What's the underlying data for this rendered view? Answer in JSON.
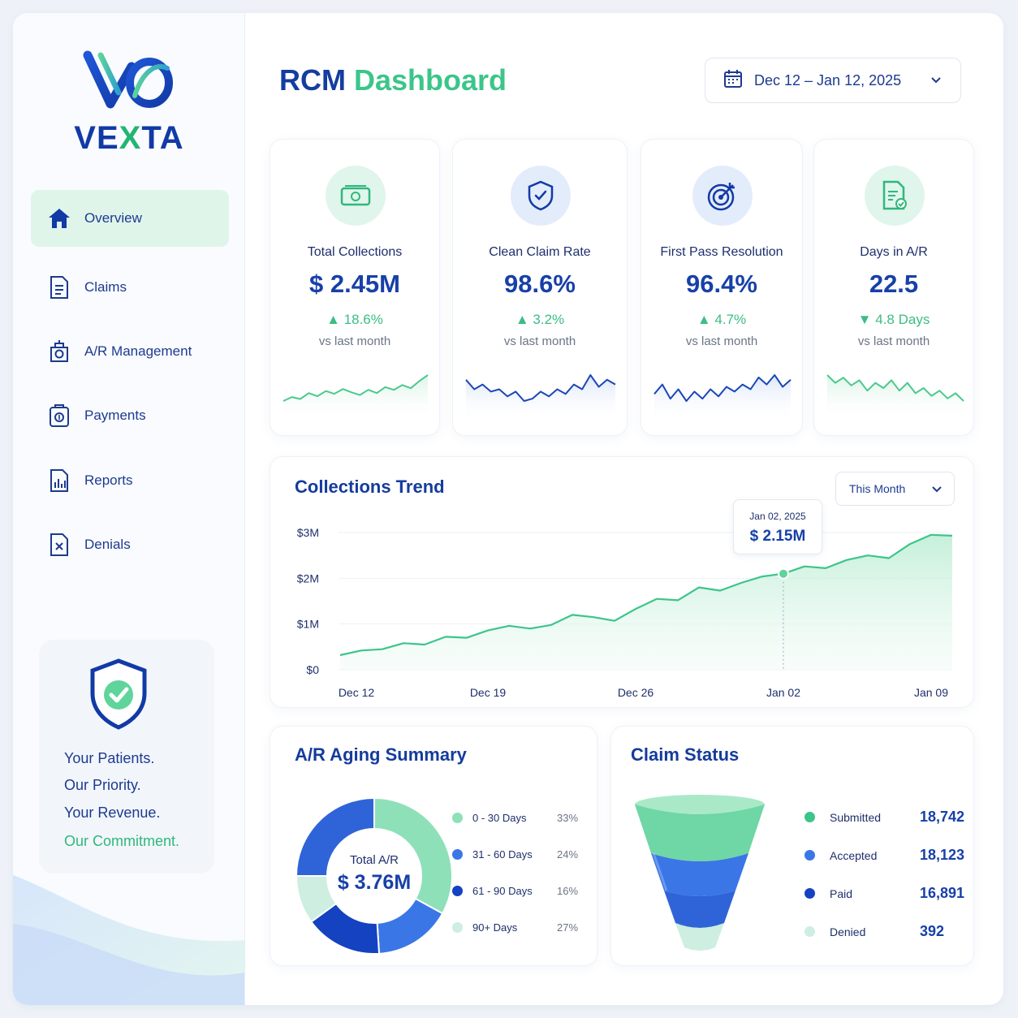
{
  "brand": {
    "name_left": "VE",
    "name_x": "X",
    "name_right": "TA"
  },
  "nav": [
    {
      "label": "Overview",
      "icon": "home-icon",
      "active": true
    },
    {
      "label": "Claims",
      "icon": "document-icon"
    },
    {
      "label": "A/R Management",
      "icon": "ar-management-icon"
    },
    {
      "label": "Payments",
      "icon": "payments-icon"
    },
    {
      "label": "Reports",
      "icon": "reports-icon"
    },
    {
      "label": "Denials",
      "icon": "denials-icon"
    }
  ],
  "promo": {
    "icon": "shield-check-icon",
    "line1": "Your Patients.",
    "line2": "Our Priority.",
    "line3": "Your Revenue.",
    "line4": "Our Commitment."
  },
  "header": {
    "title_main": "RCM",
    "title_accent": "Dashboard",
    "date_range": "Dec 12 – Jan 12, 2025"
  },
  "colors": {
    "brand_blue": "#1740a8",
    "accent_green": "#3cc58a",
    "blue_series": "#2f64d8",
    "dark_blue": "#1442c0",
    "light_green": "#cdeee0"
  },
  "kpis": [
    {
      "label": "Total Collections",
      "value": "$ 2.45M",
      "delta": "18.6%",
      "direction": "up",
      "sub": "vs last month",
      "icon": "cash-icon",
      "spark_color": "green",
      "spark": [
        3,
        4,
        3.5,
        5,
        4.2,
        5.5,
        4.8,
        6,
        5.2,
        4.5,
        5.8,
        5,
        6.5,
        5.8,
        7,
        6.2,
        8,
        9.5
      ]
    },
    {
      "label": "Clean Claim Rate",
      "value": "98.6%",
      "delta": "3.2%",
      "direction": "up",
      "sub": "vs last month",
      "icon": "shield-icon",
      "spark_color": "blue",
      "spark": [
        7,
        5,
        6,
        4.5,
        5,
        3.5,
        4.5,
        2.5,
        3,
        4.5,
        3.5,
        5,
        4,
        6,
        5,
        8,
        5.5,
        7,
        6
      ]
    },
    {
      "label": "First Pass Resolution",
      "value": "96.4%",
      "delta": "4.7%",
      "direction": "up",
      "sub": "vs last month",
      "icon": "target-icon",
      "spark_color": "blue",
      "spark": [
        4,
        6,
        3,
        5,
        2.5,
        4.5,
        3,
        5,
        3.5,
        5.5,
        4.5,
        6,
        5,
        7.5,
        6,
        8,
        5.5,
        7
      ]
    },
    {
      "label": "Days in A/R",
      "value": "22.5",
      "delta": "4.8 Days",
      "direction": "down",
      "sub": "vs last month",
      "icon": "document-check-icon",
      "spark_color": "green",
      "spark": [
        8,
        6.5,
        7.5,
        6,
        7,
        5,
        6.5,
        5.5,
        7,
        5,
        6.5,
        4.5,
        5.5,
        4,
        5,
        3.5,
        4.5,
        3
      ]
    }
  ],
  "trend": {
    "title": "Collections Trend",
    "range_select": "This Month",
    "tooltip": {
      "date": "Jan 02, 2025",
      "value": "$ 2.15M"
    }
  },
  "chart_data": {
    "type": "area",
    "title": "Collections Trend",
    "y_ticks": [
      "$3M",
      "$2M",
      "$1M",
      "$0"
    ],
    "ylim": [
      0,
      3.1
    ],
    "x_ticks": [
      "Dec 12",
      "Dec 19",
      "Dec 26",
      "Jan 02",
      "Jan 09"
    ],
    "x_tick_positions": [
      0,
      7,
      14,
      21,
      28
    ],
    "values": [
      0.32,
      0.42,
      0.45,
      0.58,
      0.55,
      0.72,
      0.7,
      0.86,
      0.96,
      0.9,
      0.98,
      1.2,
      1.15,
      1.07,
      1.33,
      1.55,
      1.52,
      1.8,
      1.73,
      1.9,
      2.04,
      2.1,
      2.26,
      2.22,
      2.4,
      2.5,
      2.44,
      2.75,
      2.95,
      2.93
    ],
    "highlight_index": 21,
    "grid": true
  },
  "aging": {
    "title": "A/R Aging Summary",
    "center_label": "Total A/R",
    "center_value": "$ 3.76M",
    "segments": [
      {
        "label": "0 - 30 Days",
        "pct": "33%",
        "value": 33,
        "color": "#8ee0b8"
      },
      {
        "label": "31 - 60 Days",
        "pct": "24%",
        "value": 24,
        "color": "#3a76e6"
      },
      {
        "label": "61 - 90 Days",
        "pct": "16%",
        "value": 16,
        "color": "#1442c0"
      },
      {
        "label": "90+ Days",
        "pct": "27%",
        "value": 27,
        "color": "#cdeee0"
      }
    ],
    "donut_render": [
      {
        "value": 33,
        "color": "#8ee0b8"
      },
      {
        "value": 16,
        "color": "#3a76e6"
      },
      {
        "value": 16,
        "color": "#1442c0"
      },
      {
        "value": 10,
        "color": "#cdeee0"
      },
      {
        "value": 25,
        "color": "#2f64d8"
      }
    ]
  },
  "claims": {
    "title": "Claim Status",
    "rows": [
      {
        "label": "Submitted",
        "value": "18,742",
        "color": "#3cc58a"
      },
      {
        "label": "Accepted",
        "value": "18,123",
        "color": "#3a76e6"
      },
      {
        "label": "Paid",
        "value": "16,891",
        "color": "#1442c0"
      },
      {
        "label": "Denied",
        "value": "392",
        "color": "#cdeee0"
      }
    ]
  }
}
